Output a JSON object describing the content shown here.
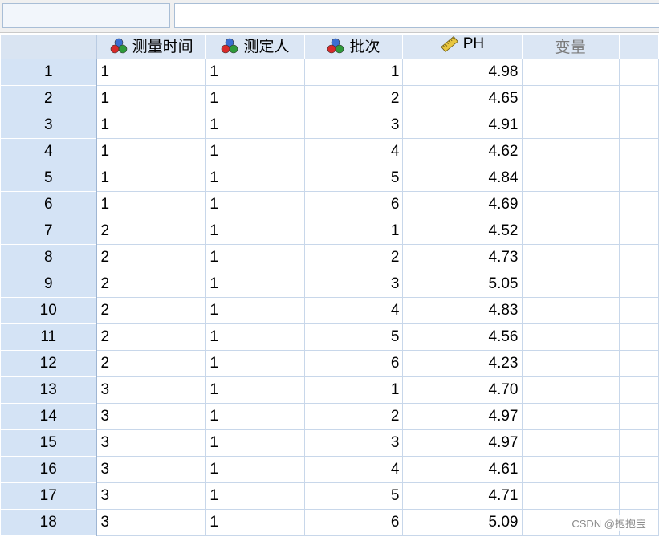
{
  "columns": [
    {
      "label": "测量时间",
      "icon": "nominal-measure-icon",
      "align": "left"
    },
    {
      "label": "测定人",
      "icon": "nominal-measure-icon",
      "align": "left"
    },
    {
      "label": "批次",
      "icon": "nominal-measure-icon",
      "align": "right"
    },
    {
      "label": "PH",
      "icon": "scale-measure-icon",
      "align": "right"
    },
    {
      "label": "变量",
      "icon": "",
      "align": "left"
    }
  ],
  "rows": [
    {
      "n": "1",
      "cells": [
        "1",
        "1",
        "1",
        "4.98"
      ]
    },
    {
      "n": "2",
      "cells": [
        "1",
        "1",
        "2",
        "4.65"
      ]
    },
    {
      "n": "3",
      "cells": [
        "1",
        "1",
        "3",
        "4.91"
      ]
    },
    {
      "n": "4",
      "cells": [
        "1",
        "1",
        "4",
        "4.62"
      ]
    },
    {
      "n": "5",
      "cells": [
        "1",
        "1",
        "5",
        "4.84"
      ]
    },
    {
      "n": "6",
      "cells": [
        "1",
        "1",
        "6",
        "4.69"
      ]
    },
    {
      "n": "7",
      "cells": [
        "2",
        "1",
        "1",
        "4.52"
      ]
    },
    {
      "n": "8",
      "cells": [
        "2",
        "1",
        "2",
        "4.73"
      ]
    },
    {
      "n": "9",
      "cells": [
        "2",
        "1",
        "3",
        "5.05"
      ]
    },
    {
      "n": "10",
      "cells": [
        "2",
        "1",
        "4",
        "4.83"
      ]
    },
    {
      "n": "11",
      "cells": [
        "2",
        "1",
        "5",
        "4.56"
      ]
    },
    {
      "n": "12",
      "cells": [
        "2",
        "1",
        "6",
        "4.23"
      ]
    },
    {
      "n": "13",
      "cells": [
        "3",
        "1",
        "1",
        "4.70"
      ]
    },
    {
      "n": "14",
      "cells": [
        "3",
        "1",
        "2",
        "4.97"
      ]
    },
    {
      "n": "15",
      "cells": [
        "3",
        "1",
        "3",
        "4.97"
      ]
    },
    {
      "n": "16",
      "cells": [
        "3",
        "1",
        "4",
        "4.61"
      ]
    },
    {
      "n": "17",
      "cells": [
        "3",
        "1",
        "5",
        "4.71"
      ]
    },
    {
      "n": "18",
      "cells": [
        "3",
        "1",
        "6",
        "5.09"
      ]
    }
  ],
  "watermark": "CSDN @抱抱宝",
  "colors": {
    "row_header_bg": "#d4e3f5",
    "col_header_bg": "#dbe6f4",
    "grid_line": "#c8d7ea"
  }
}
